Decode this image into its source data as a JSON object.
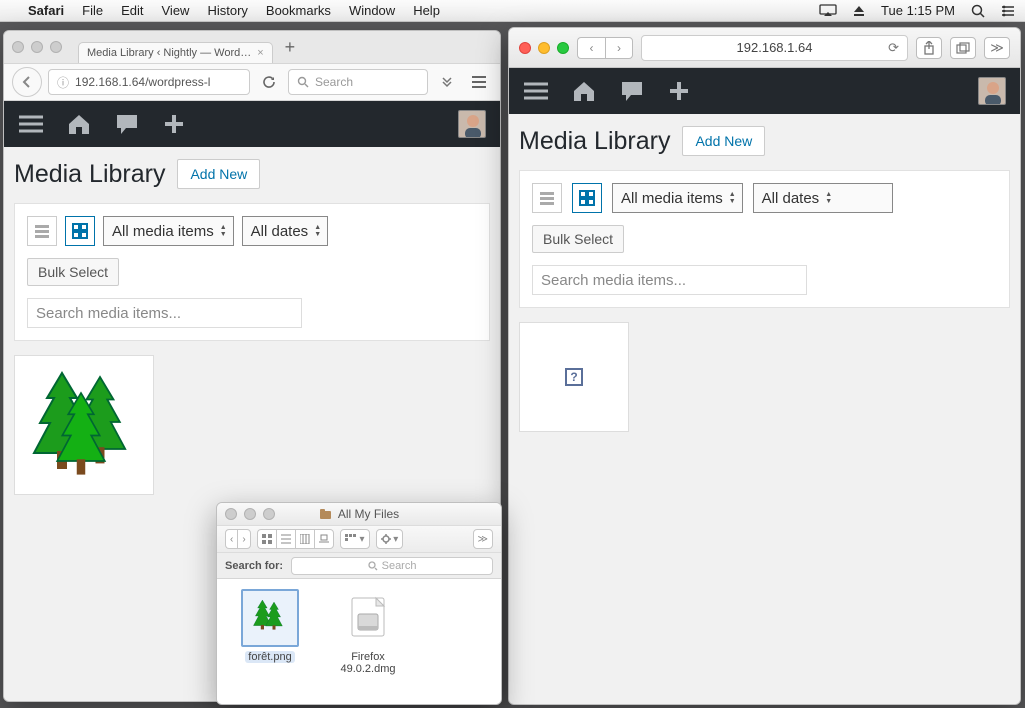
{
  "menubar": {
    "app": "Safari",
    "items": [
      "File",
      "Edit",
      "View",
      "History",
      "Bookmarks",
      "Window",
      "Help"
    ],
    "clock": "Tue 1:15 PM"
  },
  "firefox": {
    "tab_title": "Media Library ‹ Nightly — Word…",
    "url": "192.168.1.64/wordpress-l",
    "search_placeholder": "Search"
  },
  "safari": {
    "address": "192.168.1.64"
  },
  "wp": {
    "title": "Media Library",
    "add_new": "Add New",
    "filter_type": "All media items",
    "filter_date": "All dates",
    "bulk_select": "Bulk Select",
    "search_placeholder": "Search media items..."
  },
  "finder": {
    "title": "All My Files",
    "search_label": "Search for:",
    "search_placeholder": "Search",
    "files": [
      {
        "name": "forêt.png",
        "selected": true,
        "kind": "image"
      },
      {
        "name": "Firefox 49.0.2.dmg",
        "selected": false,
        "kind": "dmg"
      }
    ]
  }
}
